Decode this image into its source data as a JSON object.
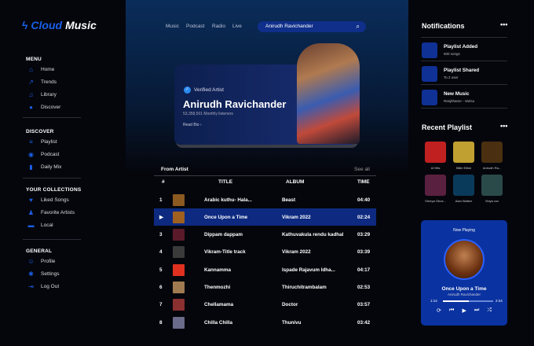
{
  "logo": {
    "part1": "Cloud",
    "part2": "Music"
  },
  "sidebar": {
    "menu_title": "MENU",
    "menu": [
      {
        "label": "Home",
        "icon": "home-icon"
      },
      {
        "label": "Trends",
        "icon": "trends-icon"
      },
      {
        "label": "Library",
        "icon": "music-note-icon"
      },
      {
        "label": "Discover",
        "icon": "compass-icon"
      }
    ],
    "discover_title": "DISCOVER",
    "discover": [
      {
        "label": "Playlist",
        "icon": "playlist-icon"
      },
      {
        "label": "Podcast",
        "icon": "podcast-icon"
      },
      {
        "label": "Daily Mix",
        "icon": "chart-icon"
      }
    ],
    "collections_title": "YOUR COLLECTIONS",
    "collections": [
      {
        "label": "Liked Songs",
        "icon": "heart-icon"
      },
      {
        "label": "Favorite Artists",
        "icon": "user-icon"
      },
      {
        "label": "Local",
        "icon": "folder-icon"
      }
    ],
    "general_title": "GENERAL",
    "general": [
      {
        "label": "Profile",
        "icon": "profile-icon"
      },
      {
        "label": "Settings",
        "icon": "gear-icon"
      },
      {
        "label": "Log Out",
        "icon": "logout-icon"
      }
    ]
  },
  "nav": [
    "Music",
    "Podcast",
    "Radio",
    "Live"
  ],
  "search": {
    "value": "Anirudh Ravichander"
  },
  "hero": {
    "badge": "Verified Artist",
    "name": "Anirudh Ravichander",
    "listeners": "53,358,501 Monthly listeners",
    "read_bio": "Read Bio"
  },
  "tracks": {
    "section": "From Artist",
    "see_all": "See all",
    "headers": {
      "num": "#",
      "title": "TITLE",
      "album": "ALBUM",
      "time": "TIME"
    },
    "rows": [
      {
        "num": "1",
        "title": "Arabic kuthu- Hala...",
        "album": "Beast",
        "time": "04:40",
        "color": "#8a5a20"
      },
      {
        "num": "▶",
        "title": "Once Upon a Time",
        "album": "Vikram 2022",
        "time": "02:24",
        "color": "#a06020",
        "active": true
      },
      {
        "num": "3",
        "title": "Dippam dappam",
        "album": "Kathuvakula rendu kadhal",
        "time": "03:29",
        "color": "#5a1a2a"
      },
      {
        "num": "4",
        "title": "Vikram-Title track",
        "album": "Vikram 2022",
        "time": "03:39",
        "color": "#3a3a3a"
      },
      {
        "num": "5",
        "title": "Kannamma",
        "album": "Ispade Rajavum Idha...",
        "time": "04:17",
        "color": "#e03020"
      },
      {
        "num": "6",
        "title": "Thenmozhi",
        "album": "Thiruchitrambalam",
        "time": "02:53",
        "color": "#a07a50"
      },
      {
        "num": "7",
        "title": "Chellamama",
        "album": "Doctor",
        "time": "03:57",
        "color": "#8a3030"
      },
      {
        "num": "8",
        "title": "Chilla Chilla",
        "album": "Thunivu",
        "time": "03:42",
        "color": "#6a6a8a"
      }
    ]
  },
  "notifications": {
    "title": "Notifications",
    "items": [
      {
        "title": "Playlist Added",
        "sub": "500 songs"
      },
      {
        "title": "Playlist Shared",
        "sub": "To 2 user"
      },
      {
        "title": "New Music",
        "sub": "Ranjithame - Varisu"
      }
    ]
  },
  "recent": {
    "title": "Recent Playlist",
    "items": [
      {
        "label": "Ul Hits",
        "color": "#c02020"
      },
      {
        "label": "Billie Eilish",
        "color": "#c0a030"
      },
      {
        "label": "Anirudh Ra...",
        "color": "#4a3010"
      },
      {
        "label": "Shreya Ghos...",
        "color": "#5a2040"
      },
      {
        "label": "Alan Walker",
        "color": "#0a3a5a"
      },
      {
        "label": "Vidya vox",
        "color": "#2a4a4a"
      }
    ]
  },
  "now_playing": {
    "label": "Now Playing",
    "title": "Once Upon a Time",
    "artist": "Anirudh Ravichander",
    "elapsed": "1:14",
    "duration": "2:24",
    "progress": 0.51
  }
}
